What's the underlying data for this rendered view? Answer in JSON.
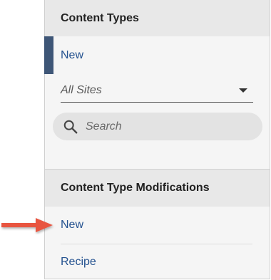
{
  "content_types": {
    "header": "Content Types",
    "items": [
      {
        "label": "New",
        "selected": true
      }
    ],
    "site_select": {
      "value": "All Sites"
    },
    "search": {
      "placeholder": "Search"
    }
  },
  "content_type_modifications": {
    "header": "Content Type Modifications",
    "items": [
      {
        "label": "New"
      },
      {
        "label": "Recipe"
      }
    ]
  },
  "colors": {
    "link": "#23518f",
    "selected_indicator": "#3e5677",
    "callout_arrow": "#e8553f"
  },
  "icons": {
    "search": "search-icon",
    "select_caret": "caret-down-icon",
    "callout": "pointer-arrow-icon"
  }
}
